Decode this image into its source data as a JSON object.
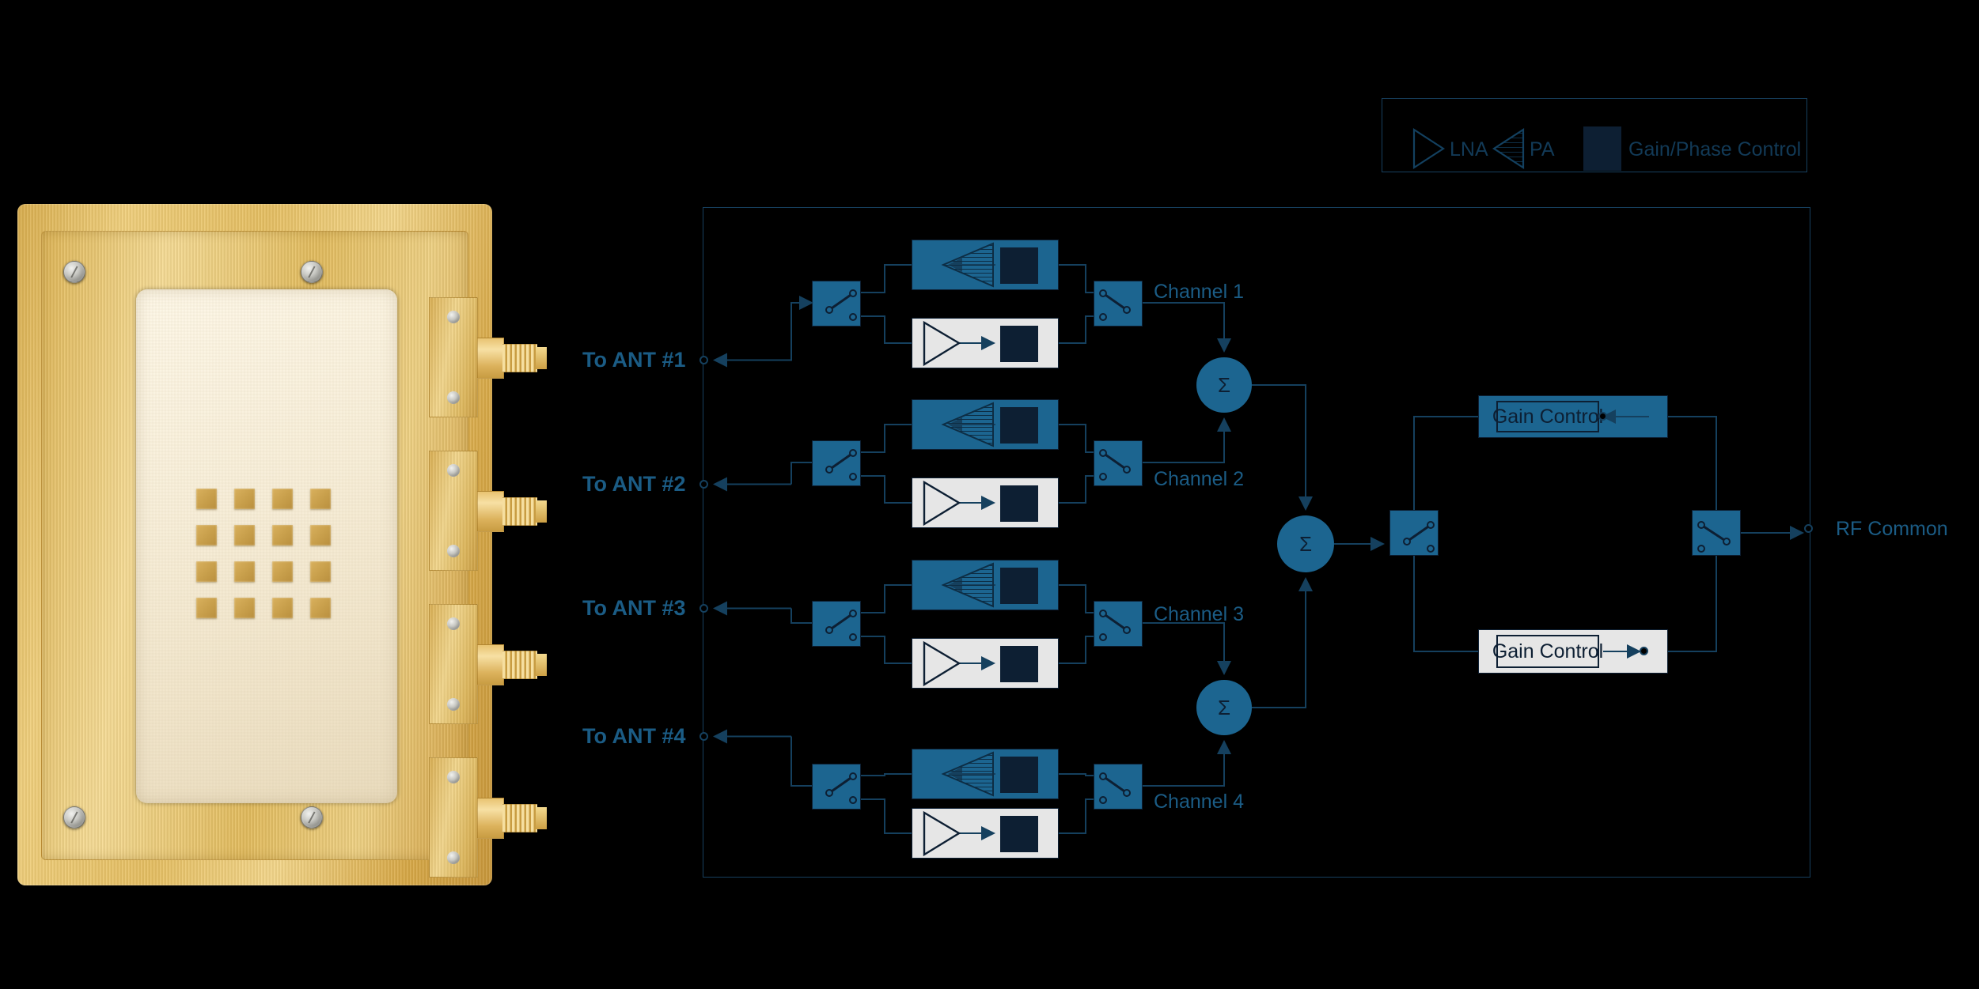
{
  "legend": {
    "items": [
      {
        "symbol": "triangle-right-outline",
        "label": "LNA"
      },
      {
        "symbol": "triangle-left-hatched",
        "label": "PA"
      },
      {
        "symbol": "dark-square",
        "label": "Gain/Phase Control"
      }
    ]
  },
  "antenna_ports": [
    {
      "label": "To ANT #1"
    },
    {
      "label": "To ANT #2"
    },
    {
      "label": "To ANT #3"
    },
    {
      "label": "To ANT #4"
    }
  ],
  "channels": [
    {
      "label": "Channel 1"
    },
    {
      "label": "Channel 2"
    },
    {
      "label": "Channel 3"
    },
    {
      "label": "Channel 4"
    }
  ],
  "summing_nodes": [
    {
      "symbol": "Σ",
      "name": "sum-ch1-ch2"
    },
    {
      "symbol": "Σ",
      "name": "sum-ch3-ch4"
    },
    {
      "symbol": "Σ",
      "name": "sum-final"
    }
  ],
  "gain_controls": [
    {
      "label": "Gain Control",
      "path": "transmit",
      "accent": "#1c6590"
    },
    {
      "label": "Gain Control",
      "path": "receive",
      "accent": "#e6e6e6"
    }
  ],
  "common_port": {
    "label": "RF Common"
  },
  "colors": {
    "background": "#000000",
    "accent_blue": "#1c6590",
    "dark_navy": "#0d1f33",
    "wire": "#15405e",
    "label_text": "#1b5c85",
    "rx_fill": "#e6e6e6",
    "gold": "#e6bf62"
  },
  "module_photo": {
    "name": "gold-beamformer-module",
    "patch_rows": 4,
    "patch_cols": 4,
    "sma_connector_count": 4,
    "corner_screw_count": 4
  }
}
